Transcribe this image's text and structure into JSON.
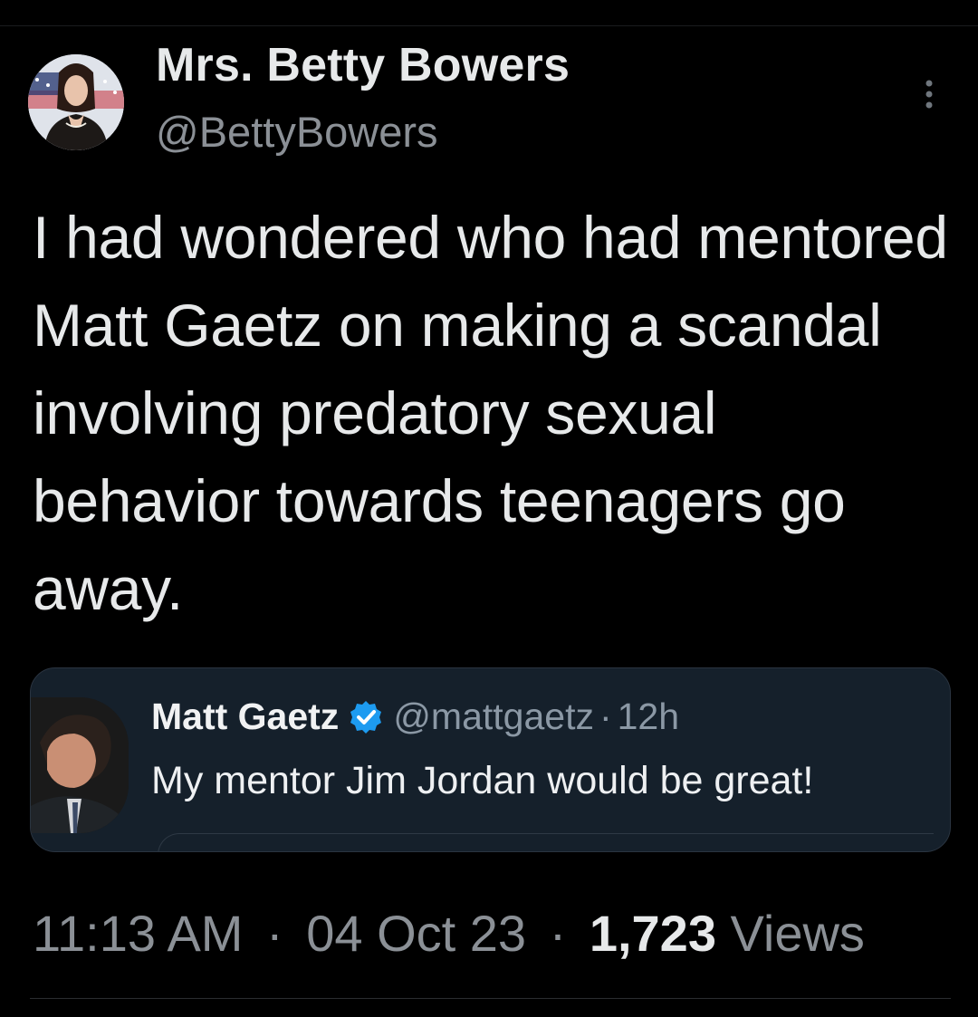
{
  "tweet": {
    "author": {
      "display_name": "Mrs. Betty Bowers",
      "handle": "@BettyBowers",
      "avatar_icon": "profile-photo"
    },
    "more_icon": "more-vertical-icon",
    "text": "I had wondered who had mentored Matt Gaetz on making a scandal involving predatory sexual behavior towards teenagers go away.",
    "quoted": {
      "display_name": "Matt Gaetz",
      "verified_icon": "verified-badge-icon",
      "handle": "@mattgaetz",
      "separator": "·",
      "time": "12h",
      "text": "My mentor Jim Jordan would be great!"
    },
    "meta": {
      "time": "11:13 AM",
      "date": "04 Oct 23",
      "views_count": "1,723",
      "views_label": "Views",
      "separator": "·"
    }
  },
  "colors": {
    "background": "#000000",
    "text_primary": "#e7e9ea",
    "text_secondary": "#8b9096",
    "quote_background": "#15202b",
    "verified": "#1d9bf0"
  }
}
